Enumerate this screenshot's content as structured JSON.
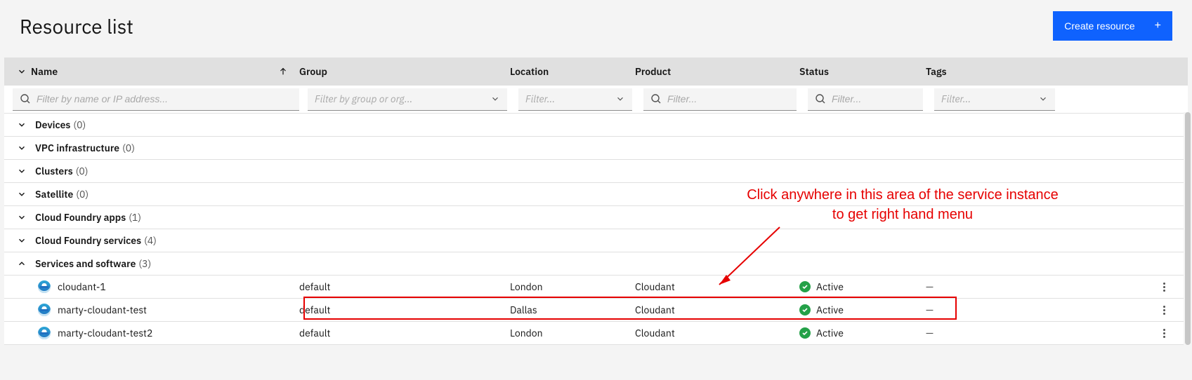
{
  "header": {
    "title": "Resource list",
    "create_label": "Create resource"
  },
  "columns": {
    "name": "Name",
    "group": "Group",
    "location": "Location",
    "product": "Product",
    "status": "Status",
    "tags": "Tags"
  },
  "filters": {
    "name_placeholder": "Filter by name or IP address...",
    "group_placeholder": "Filter by group or org...",
    "location_placeholder": "Filter...",
    "product_placeholder": "Filter...",
    "status_placeholder": "Filter...",
    "tags_placeholder": "Filter..."
  },
  "categories": [
    {
      "label": "Devices",
      "count": "(0)",
      "expanded": false
    },
    {
      "label": "VPC infrastructure",
      "count": "(0)",
      "expanded": false
    },
    {
      "label": "Clusters",
      "count": "(0)",
      "expanded": false
    },
    {
      "label": "Satellite",
      "count": "(0)",
      "expanded": false
    },
    {
      "label": "Cloud Foundry apps",
      "count": "(1)",
      "expanded": false
    },
    {
      "label": "Cloud Foundry services",
      "count": "(4)",
      "expanded": false
    },
    {
      "label": "Services and software",
      "count": "(3)",
      "expanded": true
    }
  ],
  "resources": [
    {
      "name": "cloudant-1",
      "group": "default",
      "location": "London",
      "product": "Cloudant",
      "status": "Active",
      "tags": "—"
    },
    {
      "name": "marty-cloudant-test",
      "group": "default",
      "location": "Dallas",
      "product": "Cloudant",
      "status": "Active",
      "tags": "—"
    },
    {
      "name": "marty-cloudant-test2",
      "group": "default",
      "location": "London",
      "product": "Cloudant",
      "status": "Active",
      "tags": "—"
    }
  ],
  "annotation": {
    "line1": "Click anywhere in this area of the service instance",
    "line2": "to get right hand menu"
  }
}
